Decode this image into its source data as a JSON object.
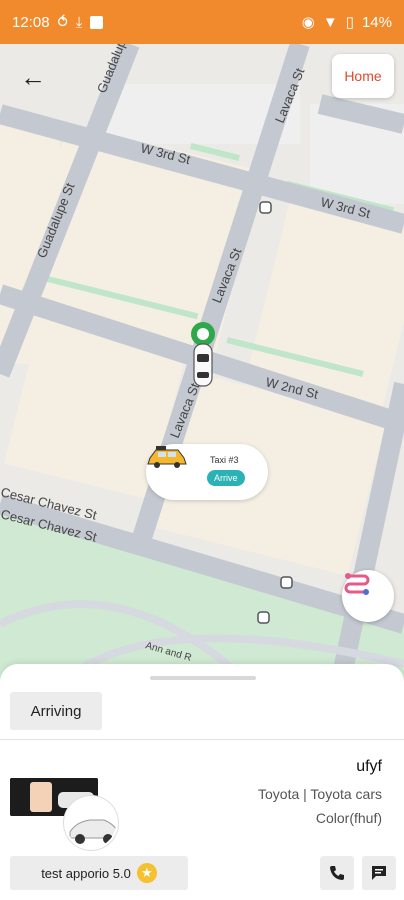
{
  "status_bar": {
    "time": "12:08",
    "battery": "14%"
  },
  "nav": {
    "home_label": "Home"
  },
  "map": {
    "streets": [
      "Guadalupe St",
      "Guadalupe St",
      "W 3rd St",
      "W 3rd St",
      "Lavaca St",
      "Lavaca St",
      "W 2nd St",
      "Lavaca St",
      "Cesar Chavez St",
      "Cesar Chavez St",
      "Ann and R"
    ],
    "taxi_marker": {
      "title": "Taxi #3",
      "badge": "Arrive"
    }
  },
  "sheet": {
    "ride_status": "Arriving",
    "driver_name": "ufyf",
    "car_model": "Toyota | Toyota cars",
    "car_color": "Color(fhuf)",
    "rating_label": "test apporio 5.0"
  },
  "colors": {
    "status_bar": "#f08a2c",
    "home_text": "#e0492c",
    "arrive_badge": "#2bb2b5",
    "star": "#f6c12e"
  }
}
